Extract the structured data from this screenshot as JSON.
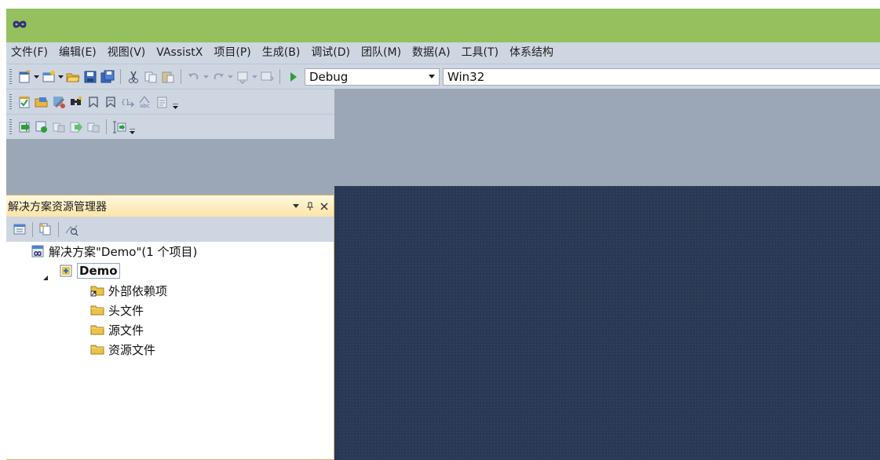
{
  "app": {
    "accent_color": "#95c05e",
    "logo_icon": "infinity-icon"
  },
  "menu": {
    "items": [
      "文件(F)",
      "编辑(E)",
      "视图(V)",
      "VAssistX",
      "项目(P)",
      "生成(B)",
      "调试(D)",
      "团队(M)",
      "数据(A)",
      "工具(T)",
      "体系结构"
    ]
  },
  "toolbar": {
    "config_value": "Debug",
    "platform_value": "Win32",
    "icons_row1": [
      "new-project-icon",
      "add-item-icon",
      "open-file-icon",
      "save-icon",
      "save-all-icon",
      "cut-icon",
      "copy-icon",
      "paste-icon",
      "undo-icon",
      "redo-icon",
      "navigate-backward-icon",
      "navigate-forward-icon",
      "start-debugging-icon"
    ],
    "icons_row2": [
      "task-list-icon",
      "open-folder-icon",
      "tools-icon",
      "find-icon",
      "bookmark-icon",
      "bookmark-next-icon",
      "code-snippet-icon",
      "spell-check-icon",
      "clipboard-icon"
    ],
    "icons_row3": [
      "build-icon",
      "rebuild-icon",
      "clean-icon",
      "build-selection-icon",
      "deploy-icon",
      "batch-build-icon"
    ]
  },
  "solution_explorer": {
    "title": "解决方案资源管理器",
    "tools": [
      "properties-icon",
      "show-all-files-icon",
      "view-class-diagram-icon"
    ],
    "solution_label": "解决方案\"Demo\"(1 个项目)",
    "project_label": "Demo",
    "folders": [
      {
        "label": "外部依赖项",
        "icon": "external-dependencies-icon"
      },
      {
        "label": "头文件",
        "icon": "folder-icon"
      },
      {
        "label": "源文件",
        "icon": "folder-icon"
      },
      {
        "label": "资源文件",
        "icon": "folder-icon"
      }
    ]
  }
}
